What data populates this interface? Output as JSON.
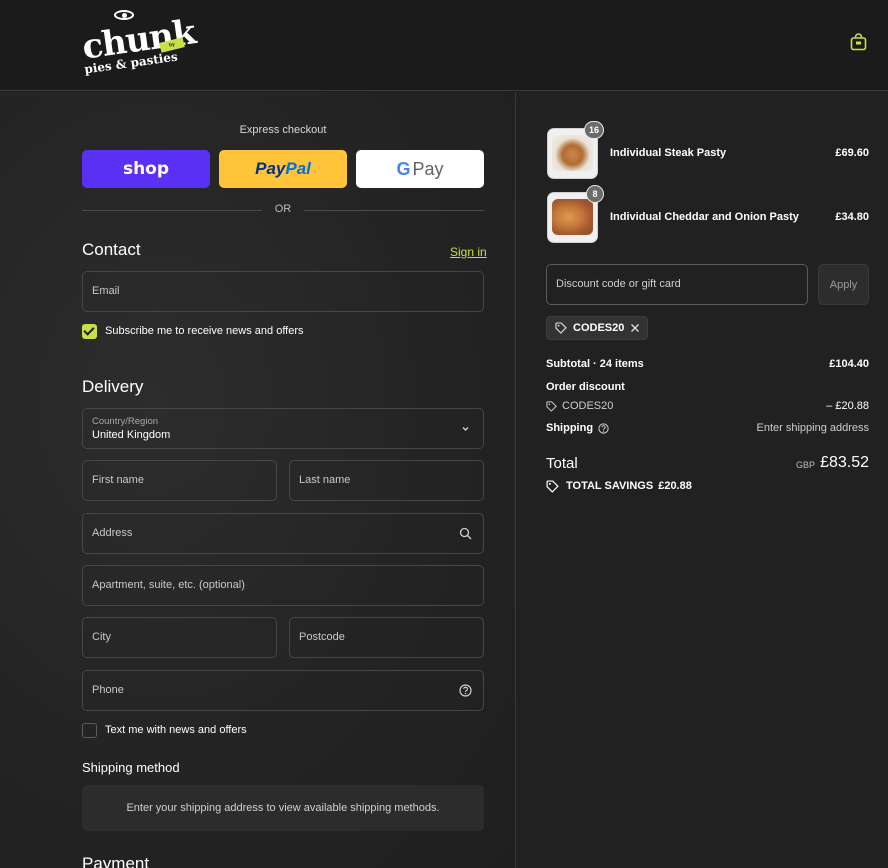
{
  "brand": {
    "logo_text": "chunk",
    "logo_subtext": "pies & pasties",
    "logo_tag": "by dartmoor"
  },
  "express": {
    "title": "Express checkout",
    "shop_label": "shop",
    "paypal_pay": "Pay",
    "paypal_pal": "Pal",
    "gpay_g": "G",
    "gpay_label": "Pay",
    "or_label": "OR"
  },
  "contact": {
    "title": "Contact",
    "signin": "Sign in",
    "email_placeholder": "Email",
    "subscribe_label": "Subscribe me to receive news and offers"
  },
  "delivery": {
    "title": "Delivery",
    "country_label": "Country/Region",
    "country_value": "United Kingdom",
    "first_name": "First name",
    "last_name": "Last name",
    "address": "Address",
    "apartment": "Apartment, suite, etc. (optional)",
    "city": "City",
    "postcode": "Postcode",
    "phone": "Phone",
    "text_me_label": "Text me with news and offers"
  },
  "shipping": {
    "title": "Shipping method",
    "message": "Enter your shipping address to view available shipping methods."
  },
  "payment": {
    "title": "Payment"
  },
  "cart": {
    "items": [
      {
        "name": "Individual Steak Pasty",
        "qty": "16",
        "price": "£69.60"
      },
      {
        "name": "Individual Cheddar and Onion Pasty",
        "qty": "8",
        "price": "£34.80"
      }
    ],
    "discount_placeholder": "Discount code or gift card",
    "apply_label": "Apply",
    "applied_code": "CODES20"
  },
  "summary": {
    "subtotal_label": "Subtotal · 24 items",
    "subtotal_value": "£104.40",
    "order_discount_label": "Order discount",
    "discount_code": "CODES20",
    "discount_value": "– £20.88",
    "shipping_label": "Shipping",
    "shipping_value": "Enter shipping address",
    "total_label": "Total",
    "currency": "GBP",
    "total_value": "£83.52",
    "savings_label": "TOTAL SAVINGS",
    "savings_value": "£20.88"
  },
  "colors": {
    "accent": "#c6e048",
    "shop": "#5a31f4",
    "paypal": "#ffc439",
    "background": "#222222"
  }
}
